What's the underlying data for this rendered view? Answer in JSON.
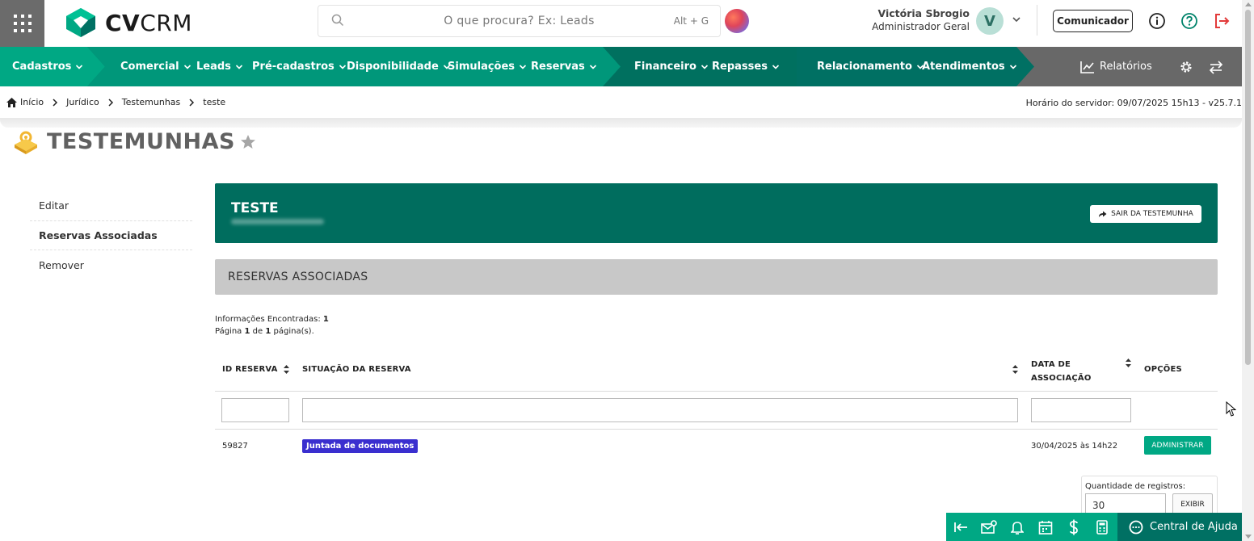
{
  "header": {
    "logo_text_bold": "CV",
    "logo_text_light": "CRM",
    "search_placeholder": "O que procura? Ex: Leads",
    "search_shortcut": "Alt + G",
    "user_name": "Victória Sbrogio",
    "user_role": "Administrador Geral",
    "avatar_initial": "V",
    "comunicador_label": "Comunicador"
  },
  "nav": {
    "items": [
      "Cadastros",
      "Comercial",
      "Leads",
      "Pré-cadastros",
      "Disponibilidade",
      "Simulações",
      "Reservas",
      "Financeiro",
      "Repasses",
      "Relacionamento",
      "Atendimentos"
    ],
    "reports_label": "Relatórios"
  },
  "breadcrumb": {
    "items": [
      "Início",
      "Jurídico",
      "Testemunhas",
      "teste"
    ],
    "server_time": "Horário do servidor: 09/07/2025 15h13 - v25.7.1"
  },
  "page": {
    "title": "TESTEMUNHAS"
  },
  "sidebar": {
    "items": [
      {
        "label": "Editar"
      },
      {
        "label": "Reservas Associadas"
      },
      {
        "label": "Remover"
      }
    ]
  },
  "card": {
    "title": "TESTE",
    "exit_label": "SAIR DA TESTEMUNHA"
  },
  "section": {
    "title": "RESERVAS ASSOCIADAS",
    "found_label": "Informações Encontradas:",
    "found_count": "1",
    "page_prefix": "Página",
    "page_current": "1",
    "page_of": "de",
    "page_total": "1",
    "page_suffix": "página(s)."
  },
  "table": {
    "headers": {
      "id": "ID RESERVA",
      "status": "SITUAÇÃO DA RESERVA",
      "date_line1": "DATA DE",
      "date_line2": "ASSOCIAÇÃO",
      "options": "OPÇÕES"
    },
    "rows": [
      {
        "id": "59827",
        "status": "Juntada de documentos",
        "date": "30/04/2025 às 14h22",
        "action": "ADMINISTRAR"
      }
    ]
  },
  "pagination": {
    "qty_label": "Quantidade de registros:",
    "qty_value": "30",
    "show_label": "EXIBIR"
  },
  "footer": {
    "help_label": "Central de Ajuda"
  },
  "colors": {
    "brand_dark": "#007063",
    "brand_light": "#00a884",
    "badge": "#3a2fcf"
  }
}
